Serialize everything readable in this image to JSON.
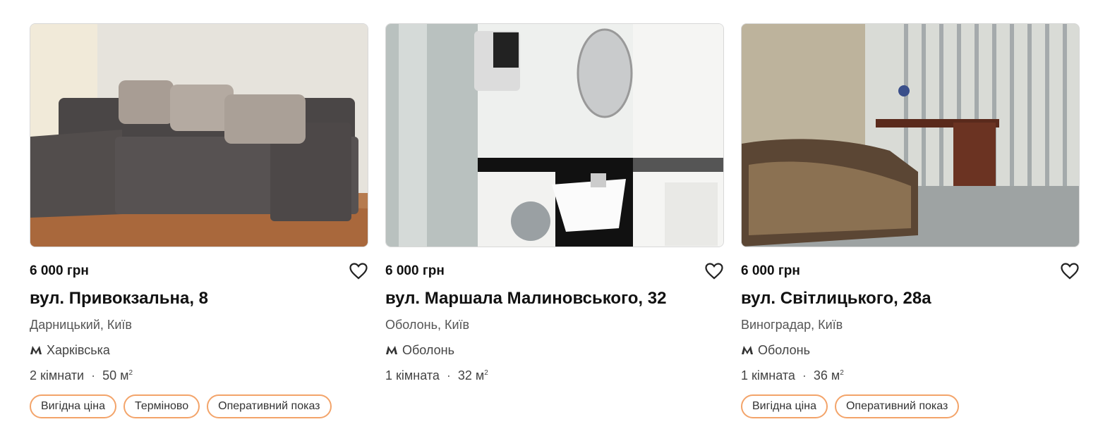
{
  "listings": [
    {
      "price": "6 000 грн",
      "address": "вул. Привокзальна, 8",
      "district": "Дарницький, Київ",
      "metro": "Харківська",
      "rooms": "2 кімнати",
      "area": "50 м",
      "area_unit_sup": "2",
      "tags": [
        "Вигідна ціна",
        "Терміново",
        "Оперативний показ"
      ]
    },
    {
      "price": "6 000 грн",
      "address": "вул. Маршала Малиновського, 32",
      "district": "Оболонь, Київ",
      "metro": "Оболонь",
      "rooms": "1 кімната",
      "area": "32 м",
      "area_unit_sup": "2",
      "tags": []
    },
    {
      "price": "6 000 грн",
      "address": "вул. Світлицького, 28а",
      "district": "Виноградар, Київ",
      "metro": "Оболонь",
      "rooms": "1 кімната",
      "area": "36 м",
      "area_unit_sup": "2",
      "tags": [
        "Вигідна ціна",
        "Оперативний показ"
      ]
    }
  ],
  "colors": {
    "tag_border": "#f3a46a",
    "text": "#111111",
    "muted": "#555555"
  },
  "icons": {
    "favorite": "heart-outline-icon",
    "metro": "metro-m-icon",
    "separator": "·"
  },
  "photo_images": [
    "NAME",
    "NAME",
    "NAME"
  ]
}
